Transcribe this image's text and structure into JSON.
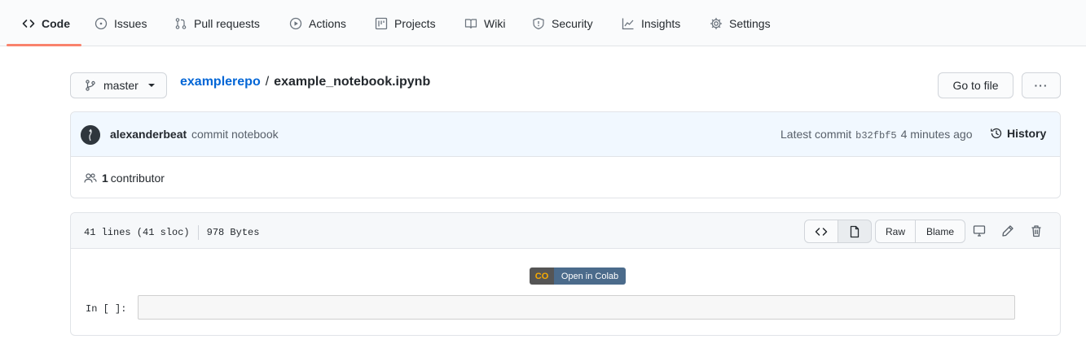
{
  "nav": {
    "tabs": [
      {
        "label": "Code",
        "icon": "code-icon"
      },
      {
        "label": "Issues",
        "icon": "issue-icon"
      },
      {
        "label": "Pull requests",
        "icon": "pull-request-icon"
      },
      {
        "label": "Actions",
        "icon": "play-icon"
      },
      {
        "label": "Projects",
        "icon": "project-icon"
      },
      {
        "label": "Wiki",
        "icon": "book-icon"
      },
      {
        "label": "Security",
        "icon": "shield-icon"
      },
      {
        "label": "Insights",
        "icon": "graph-icon"
      },
      {
        "label": "Settings",
        "icon": "gear-icon"
      }
    ],
    "active_tab": "Code"
  },
  "branch": {
    "name": "master"
  },
  "breadcrumb": {
    "repo": "examplerepo",
    "separator": "/",
    "file": "example_notebook.ipynb"
  },
  "buttons": {
    "go_to_file": "Go to file",
    "more": "···"
  },
  "commit": {
    "author": "alexanderbeat",
    "message": "commit notebook",
    "latest_label": "Latest commit",
    "sha": "b32fbf5",
    "time": "4 minutes ago",
    "history_label": "History"
  },
  "contributors": {
    "count": "1",
    "label": "contributor"
  },
  "file": {
    "lines": "41 lines (41 sloc)",
    "size": "978 Bytes",
    "raw_label": "Raw",
    "blame_label": "Blame"
  },
  "notebook": {
    "colab_badge": "Open in Colab",
    "colab_logo": "CO",
    "cell_prompt": "In [ ]:"
  },
  "colors": {
    "accent_underline": "#f9826c",
    "link": "#0366d6",
    "commit_bg": "#f1f8ff",
    "colab_blue": "#4b6b8b"
  }
}
